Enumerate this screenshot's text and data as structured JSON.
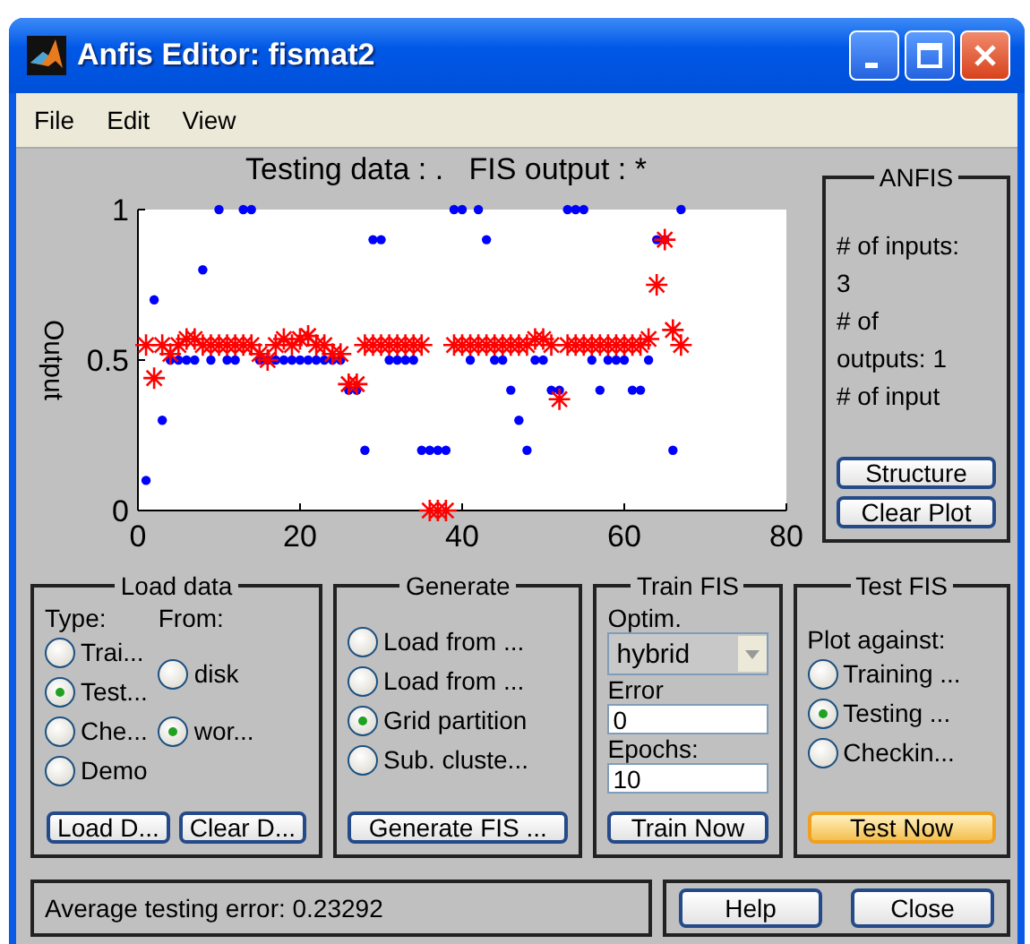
{
  "window": {
    "title": "Anfis Editor: fismat2"
  },
  "menu": [
    "File",
    "Edit",
    "View"
  ],
  "plot": {
    "chart_data": {
      "type": "scatter",
      "title": "Testing data : .   FIS output : *",
      "ylabel": "Output",
      "xlim": [
        0,
        80
      ],
      "ylim": [
        0,
        1
      ],
      "xticks": [
        0,
        20,
        40,
        60,
        80
      ],
      "yticks": [
        0,
        {
          "value": 0.5,
          "label": "0.5"
        },
        1
      ],
      "x": [
        1,
        2,
        3,
        4,
        5,
        6,
        7,
        8,
        9,
        10,
        11,
        12,
        13,
        14,
        15,
        16,
        17,
        18,
        19,
        20,
        21,
        22,
        23,
        24,
        25,
        26,
        27,
        28,
        29,
        30,
        31,
        32,
        33,
        34,
        35,
        36,
        37,
        38,
        39,
        40,
        41,
        42,
        43,
        44,
        45,
        46,
        47,
        48,
        49,
        50,
        51,
        52,
        53,
        54,
        55,
        56,
        57,
        58,
        59,
        60,
        61,
        62,
        63,
        64,
        65,
        66,
        67
      ],
      "series": [
        {
          "color": "#0000ff",
          "values": [
            0.1,
            0.7,
            0.3,
            0.5,
            0.5,
            0.5,
            0.5,
            0.8,
            0.5,
            1,
            0.5,
            0.5,
            1,
            1,
            0.5,
            0.5,
            0.5,
            0.5,
            0.5,
            0.5,
            0.5,
            0.5,
            0.5,
            0.5,
            0.5,
            0.4,
            0.4,
            0.2,
            0.9,
            0.9,
            0.5,
            0.5,
            0.5,
            0.5,
            0.2,
            0.2,
            0.2,
            0.2,
            1,
            1,
            0.5,
            1,
            0.9,
            0.5,
            0.5,
            0.4,
            0.3,
            0.2,
            0.5,
            0.5,
            0.4,
            0.4,
            1,
            1,
            1,
            0.5,
            0.4,
            0.5,
            0.5,
            0.5,
            0.4,
            0.4,
            0.5,
            0.9,
            0.9,
            0.2,
            1
          ]
        },
        {
          "color": "#ff0000",
          "values": [
            0.55,
            0.44,
            0.55,
            0.52,
            0.55,
            0.57,
            0.57,
            0.55,
            0.55,
            0.55,
            0.55,
            0.55,
            0.55,
            0.55,
            0.52,
            0.5,
            0.55,
            0.57,
            0.55,
            0.57,
            0.58,
            0.55,
            0.55,
            0.52,
            0.52,
            0.42,
            0.42,
            0.55,
            0.55,
            0.55,
            0.55,
            0.55,
            0.55,
            0.55,
            0.55,
            0,
            0,
            0,
            0.55,
            0.55,
            0.55,
            0.55,
            0.55,
            0.55,
            0.55,
            0.55,
            0.55,
            0.55,
            0.57,
            0.57,
            0.55,
            0.37,
            0.55,
            0.55,
            0.55,
            0.55,
            0.55,
            0.55,
            0.55,
            0.55,
            0.55,
            0.55,
            0.57,
            0.75,
            0.9,
            0.6,
            0.55
          ]
        }
      ]
    }
  },
  "anfis_info": {
    "title": "ANFIS",
    "lines": [
      "# of inputs:",
      "3",
      "# of",
      "outputs: 1",
      "# of input"
    ],
    "buttons": [
      "Structure",
      "Clear Plot"
    ]
  },
  "load_data": {
    "title": "Load data",
    "type_label": "Type:",
    "from_label": "From:",
    "types": [
      {
        "label": "Trai...",
        "selected": false
      },
      {
        "label": "Test...",
        "selected": true
      },
      {
        "label": "Che...",
        "selected": false
      },
      {
        "label": "Demo",
        "selected": false
      }
    ],
    "sources": [
      {
        "label": "disk",
        "selected": false
      },
      {
        "label": "wor...",
        "selected": true
      }
    ],
    "buttons": [
      "Load D...",
      "Clear D..."
    ]
  },
  "generate": {
    "title": "Generate",
    "options": [
      {
        "label": "Load from ...",
        "selected": false
      },
      {
        "label": "Load from ...",
        "selected": false
      },
      {
        "label": "Grid partition",
        "selected": true
      },
      {
        "label": "Sub. cluste...",
        "selected": false
      }
    ],
    "button": "Generate FIS ..."
  },
  "train": {
    "title": "Train FIS",
    "optim_label": "Optim.",
    "optim_value": "hybrid",
    "error_label": "Error",
    "error_value": "0",
    "epochs_label": "Epochs:",
    "epochs_value": "10",
    "button": "Train Now"
  },
  "test": {
    "title": "Test FIS",
    "plot_label": "Plot against:",
    "options": [
      {
        "label": "Training ...",
        "selected": false
      },
      {
        "label": "Testing ...",
        "selected": true
      },
      {
        "label": "Checkin...",
        "selected": false
      }
    ],
    "button": "Test Now",
    "focused": true
  },
  "status": "Average testing error: 0.23292",
  "buttons": [
    "Help",
    "Close"
  ]
}
